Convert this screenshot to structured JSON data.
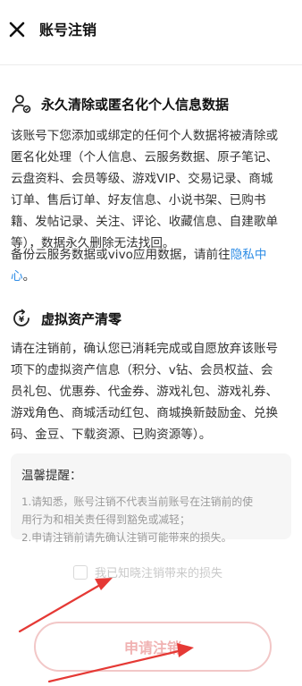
{
  "header": {
    "title": "账号注销"
  },
  "section1": {
    "heading": "永久清除或匿名化个人信息数据",
    "lines": [
      "该账号下您添加或绑定的任何个人数据将被清除或",
      "匿名化处理（个人信息、云服务数据、原子笔记、",
      "云盘资料、会员等级、游戏VIP、交易记录、商城",
      "订单、售后订单、好友信息、小说书架、已购书",
      "籍、发帖记录、关注、评论、收藏信息、自建歌单",
      "等），数据永久删除无法找回。"
    ],
    "backup_line1_pre": "备份云服务数据或vivo应用数据，请前往",
    "backup_link_part1": "隐私中",
    "backup_link_part2": "心",
    "backup_end": "。"
  },
  "section2": {
    "heading": "虚拟资产清零",
    "lines": [
      "请在注销前，确认您已消耗完成或自愿放弃该账号",
      "项下的虚拟资产信息（积分、v钻、会员权益、会",
      "员礼包、优惠券、代金券、游戏礼包、游戏礼券、",
      "游戏角色、商城活动红包、商城换新鼓励金、兑换",
      "码、金豆、下载资源、已购资源等）。"
    ]
  },
  "tips": {
    "title": "温馨提醒：",
    "lines": [
      "1.请知悉，账号注销不代表当前账号在注销前的使",
      "用行为和相关责任得到豁免或减轻；",
      "2.申请注销前请先确认注销可能带来的损失。"
    ]
  },
  "agreement": {
    "label": "我已知晓注销带来的损失",
    "checked": false
  },
  "submit": {
    "label": "申请注销"
  },
  "colors": {
    "link": "#2f8de6",
    "button_border": "#f2c7c7",
    "button_text": "#f0b2b2",
    "arrow": "#e53935"
  },
  "icons": {
    "close": "close-icon",
    "privacy": "user-privacy-icon",
    "asset": "yen-reset-icon"
  }
}
